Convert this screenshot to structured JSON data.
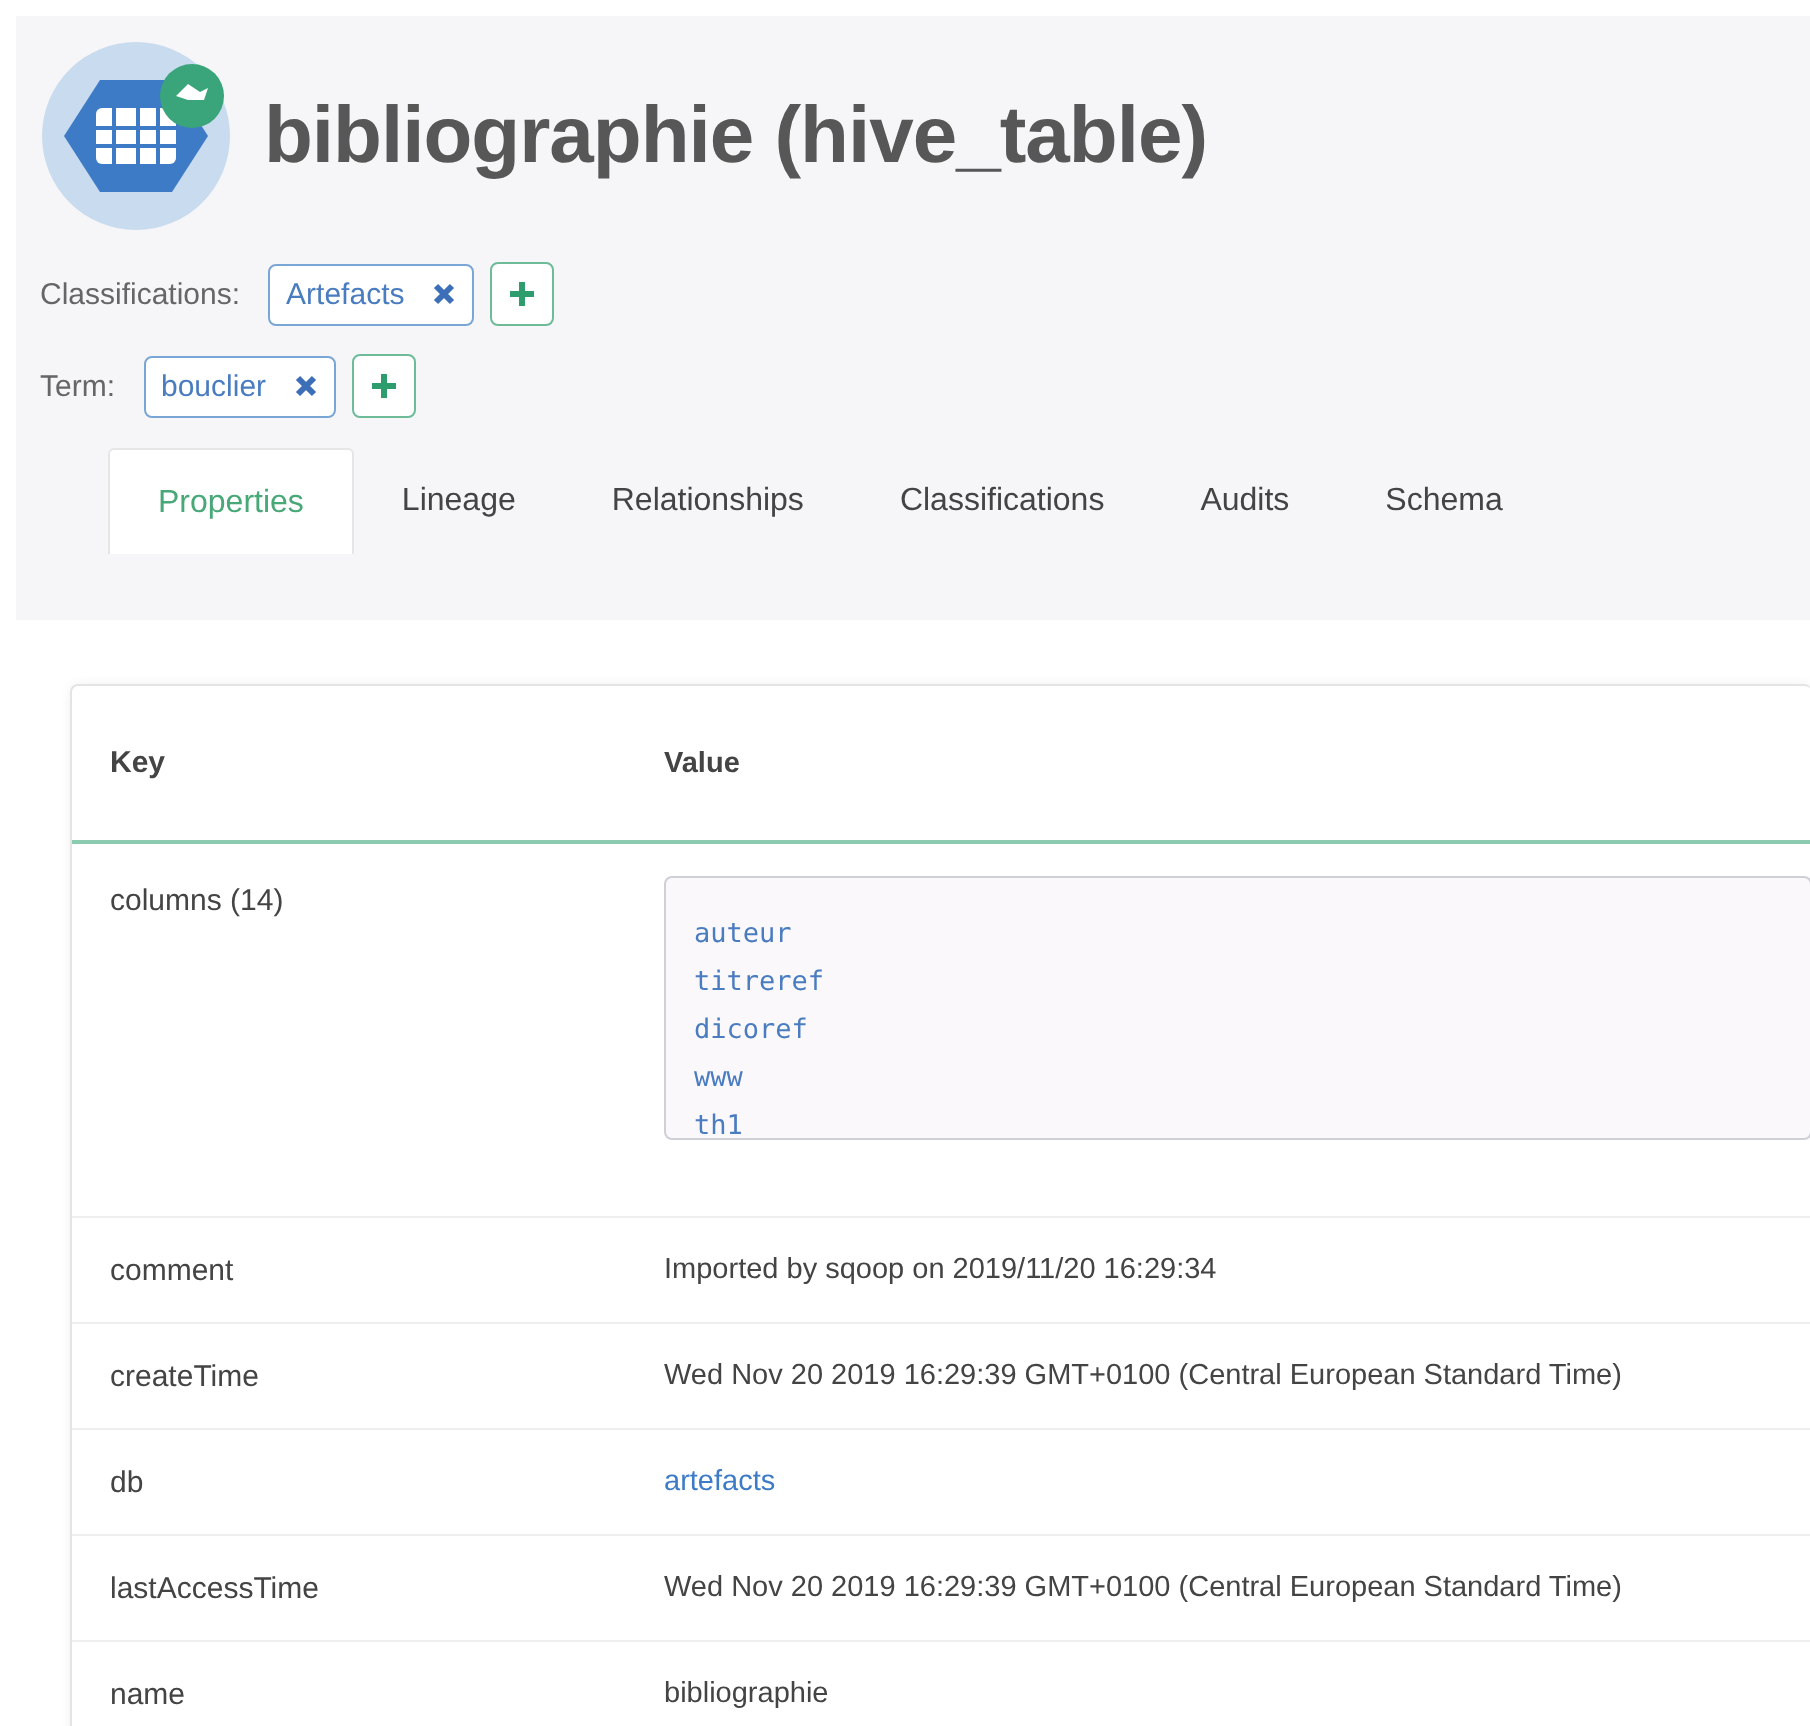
{
  "header": {
    "title": "bibliographie (hive_table)"
  },
  "classifications": {
    "label": "Classifications:",
    "tags": [
      "Artefacts"
    ]
  },
  "term": {
    "label": "Term:",
    "tags": [
      "bouclier"
    ]
  },
  "tabs": [
    {
      "label": "Properties",
      "selected": true
    },
    {
      "label": "Lineage",
      "selected": false
    },
    {
      "label": "Relationships",
      "selected": false
    },
    {
      "label": "Classifications",
      "selected": false
    },
    {
      "label": "Audits",
      "selected": false
    },
    {
      "label": "Schema",
      "selected": false
    }
  ],
  "table": {
    "columns": [
      "Key",
      "Value"
    ],
    "rows": [
      {
        "key": "columns (14)",
        "kind": "list",
        "items": [
          "auteur",
          "titreref",
          "dicoref",
          "www",
          "th1"
        ]
      },
      {
        "key": "comment",
        "kind": "text",
        "value": "Imported by sqoop on 2019/11/20 16:29:34"
      },
      {
        "key": "createTime",
        "kind": "text",
        "value": "Wed Nov 20 2019 16:29:39 GMT+0100 (Central European Standard Time)"
      },
      {
        "key": "db",
        "kind": "link",
        "value": "artefacts"
      },
      {
        "key": "lastAccessTime",
        "kind": "text",
        "value": "Wed Nov 20 2019 16:29:39 GMT+0100 (Central European Standard Time)"
      },
      {
        "key": "name",
        "kind": "text",
        "value": "bibliographie"
      }
    ]
  }
}
